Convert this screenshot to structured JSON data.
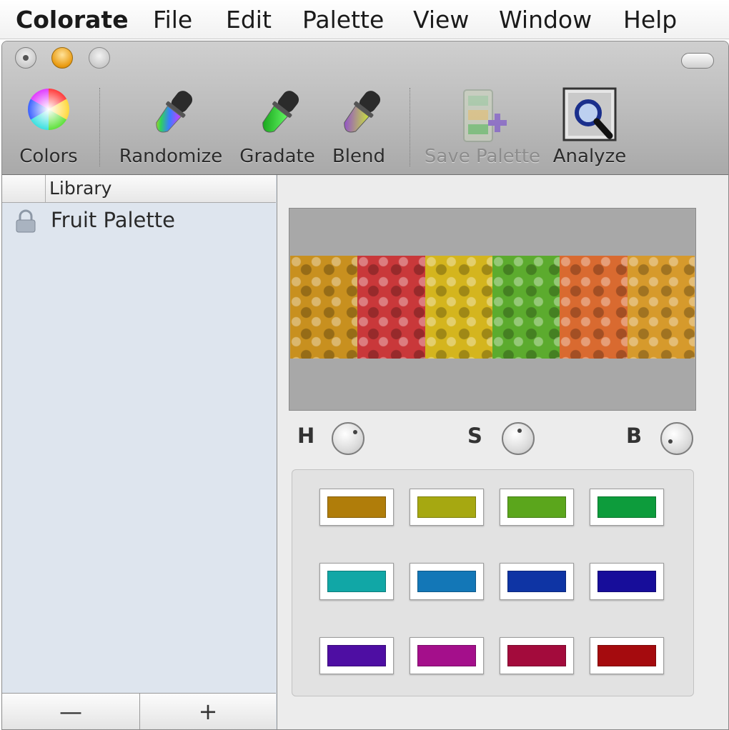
{
  "menubar": {
    "app_name": "Colorate",
    "items": [
      "File",
      "Edit",
      "Palette",
      "View",
      "Window",
      "Help"
    ]
  },
  "toolbar": {
    "tools": [
      {
        "label": "Colors",
        "icon": "color-wheel-icon",
        "enabled": true
      },
      {
        "label": "Randomize",
        "icon": "rainbow-dropper-icon",
        "enabled": true
      },
      {
        "label": "Gradate",
        "icon": "green-dropper-icon",
        "enabled": true
      },
      {
        "label": "Blend",
        "icon": "purple-dropper-icon",
        "enabled": true
      },
      {
        "label": "Save Palette",
        "icon": "save-palette-icon",
        "enabled": false
      },
      {
        "label": "Analyze",
        "icon": "magnifier-icon",
        "enabled": true
      }
    ]
  },
  "sidebar": {
    "header_label": "Library",
    "items": [
      {
        "label": "Fruit Palette",
        "icon": "lock-icon"
      }
    ],
    "footer": {
      "remove_label": "—",
      "add_label": "+"
    }
  },
  "analysis": {
    "knobs": [
      {
        "label": "H",
        "icon": "hue-knob"
      },
      {
        "label": "S",
        "icon": "saturation-knob"
      },
      {
        "label": "B",
        "icon": "brightness-knob"
      }
    ],
    "image_segments": [
      "#c8901f",
      "#c9383a",
      "#d4b51e",
      "#5cab2e",
      "#d96a30",
      "#d69a2c"
    ]
  },
  "palette": {
    "swatches": [
      "#b07d0a",
      "#a6a811",
      "#5ba61c",
      "#0d9c3c",
      "#11a7a6",
      "#1377b7",
      "#0e34a4",
      "#170d9a",
      "#4e0ea3",
      "#a40f8b",
      "#a30b3c",
      "#a50b0e"
    ]
  }
}
